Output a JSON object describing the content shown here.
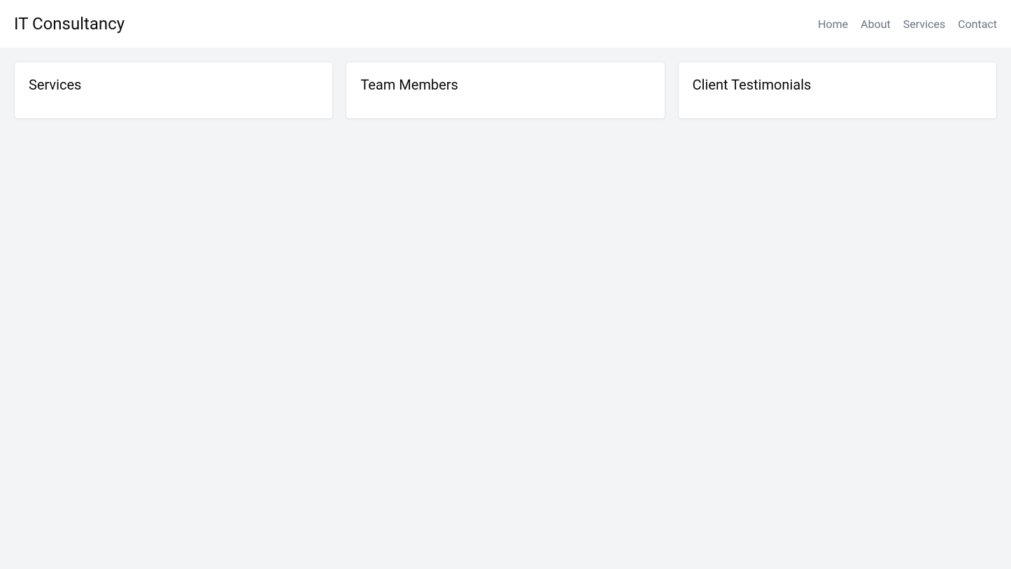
{
  "header": {
    "logo": "IT Consultancy",
    "nav": {
      "home": "Home",
      "about": "About",
      "services": "Services",
      "contact": "Contact"
    }
  },
  "main": {
    "cards": {
      "services": {
        "title": "Services"
      },
      "team": {
        "title": "Team Members"
      },
      "testimonials": {
        "title": "Client Testimonials"
      }
    }
  }
}
